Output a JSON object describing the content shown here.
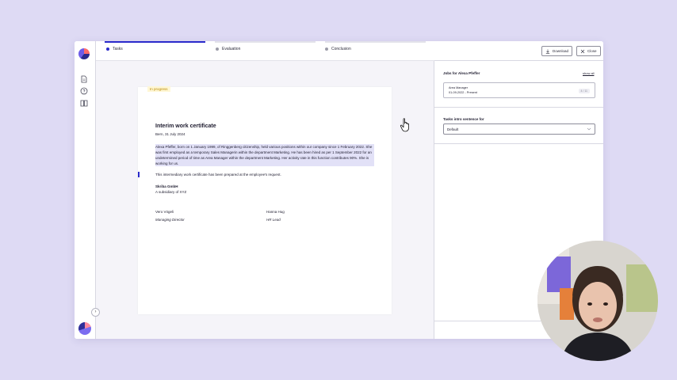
{
  "steps": [
    {
      "label": "Tasks",
      "active": true
    },
    {
      "label": "Evaluation",
      "active": false
    },
    {
      "label": "Conclusion",
      "active": false
    }
  ],
  "document": {
    "status_badge": "In progress",
    "title": "Interim work certificate",
    "place_date": "Bern, 31 July 2024",
    "paragraph": "Alexa Pfeffer, born on 1 January 1999, of Ringgenberg citizenship, held various positions within our company since 1 February 2022. She was first employed as a temporary Sales Managerin within the department Marketing. He has been hired as per 1 September 2022 for an undetermined period of time as Area Manager within the department Marketing. Her activity rate in this function contributes 90%. She is working for us.",
    "statement": "This intermediary work certificate has been prepared at the employee's request.",
    "company": "Skriba GmbH",
    "company_sub": "A subsidiary of XYZ",
    "signatories": [
      {
        "name": "Vero Vögeli",
        "role": "Managing Director"
      },
      {
        "name": "Hanna Hug",
        "role": "HR Lead"
      }
    ]
  },
  "panel": {
    "download_label": "Download",
    "close_label": "Close",
    "jobs_title": "Jobs for Alexa Pfeffer",
    "show_all": "show all",
    "job": {
      "title": "Area Manager",
      "dates": "01-09-2022 - Present",
      "count": "4 / 11"
    },
    "tasks_title": "Tasks intro sentence for",
    "tasks_select_value": "Default"
  },
  "colors": {
    "accent": "#2a2acb",
    "highlight": "#e2e1f7",
    "background": "#dedaf4"
  },
  "icons": [
    "document-icon",
    "help-icon",
    "book-icon",
    "download-icon",
    "close-icon",
    "chevron-down-icon",
    "hand-cursor-icon"
  ]
}
